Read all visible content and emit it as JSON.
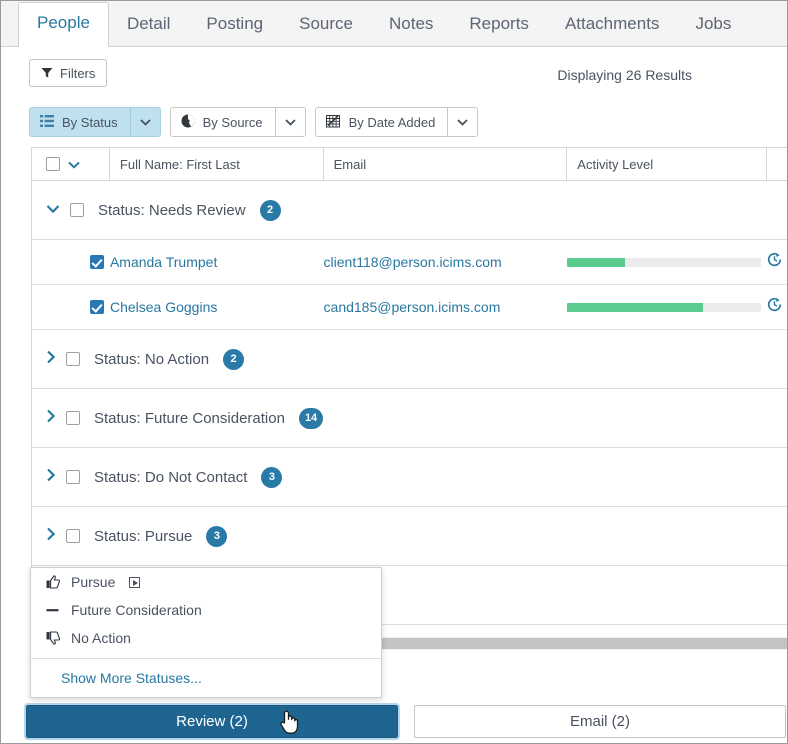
{
  "tabs": [
    {
      "label": "People",
      "active": true
    },
    {
      "label": "Detail",
      "active": false
    },
    {
      "label": "Posting",
      "active": false
    },
    {
      "label": "Source",
      "active": false
    },
    {
      "label": "Notes",
      "active": false
    },
    {
      "label": "Reports",
      "active": false
    },
    {
      "label": "Attachments",
      "active": false
    },
    {
      "label": "Jobs",
      "active": false
    }
  ],
  "toolbar": {
    "filters_label": "Filters",
    "results_label": "Displaying 26 Results"
  },
  "sort_options": [
    {
      "label": "By Status",
      "icon": "list-icon",
      "selected": true
    },
    {
      "label": "By Source",
      "icon": "pie-chart-icon",
      "selected": false
    },
    {
      "label": "By Date Added",
      "icon": "calendar-grid-icon",
      "selected": false
    }
  ],
  "table": {
    "columns": [
      "",
      "Full Name: First Last",
      "Email",
      "Activity Level",
      ""
    ],
    "groups": [
      {
        "label": "Status: Needs Review",
        "count": "2",
        "expanded": true,
        "checked": false,
        "rows": [
          {
            "name": "Amanda Trumpet",
            "email": "client118@person.icims.com",
            "activity_percent": 30,
            "checked": true
          },
          {
            "name": "Chelsea Goggins",
            "email": "cand185@person.icims.com",
            "activity_percent": 70,
            "checked": true
          }
        ]
      },
      {
        "label": "Status: No Action",
        "count": "2",
        "expanded": false,
        "checked": false,
        "rows": []
      },
      {
        "label": "Status: Future Consideration",
        "count": "14",
        "expanded": false,
        "checked": false,
        "rows": []
      },
      {
        "label": "Status: Do Not Contact",
        "count": "3",
        "expanded": false,
        "checked": false,
        "rows": []
      },
      {
        "label": "Status: Pursue",
        "count": "3",
        "expanded": false,
        "checked": false,
        "rows": []
      }
    ]
  },
  "status_menu": {
    "items": [
      {
        "label": "Pursue",
        "icon": "thumbs-up-icon",
        "has_submenu": true
      },
      {
        "label": "Future Consideration",
        "icon": "dash-icon",
        "has_submenu": false
      },
      {
        "label": "No Action",
        "icon": "thumbs-down-icon",
        "has_submenu": false
      }
    ],
    "more_label": "Show More Statuses..."
  },
  "footer": {
    "review_label": "Review  (2)",
    "email_label": "Email  (2)"
  },
  "colors": {
    "accent_blue": "#2878a0",
    "primary_button": "#1e6691",
    "badge": "#2a7aa8",
    "activity_green": "#5bcb8f",
    "selected_segment": "#bfe0ef"
  }
}
